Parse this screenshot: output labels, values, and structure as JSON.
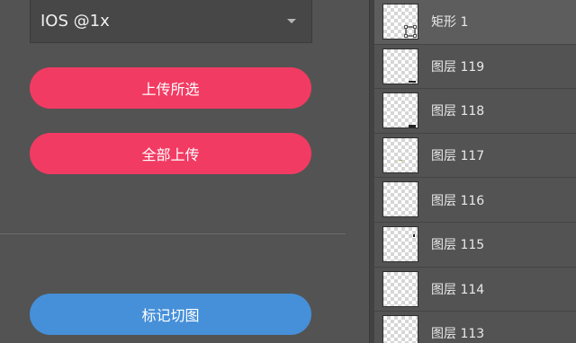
{
  "export_panel": {
    "scale_select": {
      "value": "IOS @1x"
    },
    "upload_selected_label": "上传所选",
    "upload_all_label": "全部上传",
    "mark_slices_label": "标记切图"
  },
  "layers": [
    {
      "name": "矩形 1",
      "icon": "shape-layer-icon"
    },
    {
      "name": "图层 119"
    },
    {
      "name": "图层 118"
    },
    {
      "name": "图层 117"
    },
    {
      "name": "图层 116"
    },
    {
      "name": "图层 115"
    },
    {
      "name": "图层 114"
    },
    {
      "name": "图层 113"
    }
  ],
  "colors": {
    "upload_button": "#f23b63",
    "mark_button": "#4690d9",
    "panel_bg": "#535353"
  }
}
